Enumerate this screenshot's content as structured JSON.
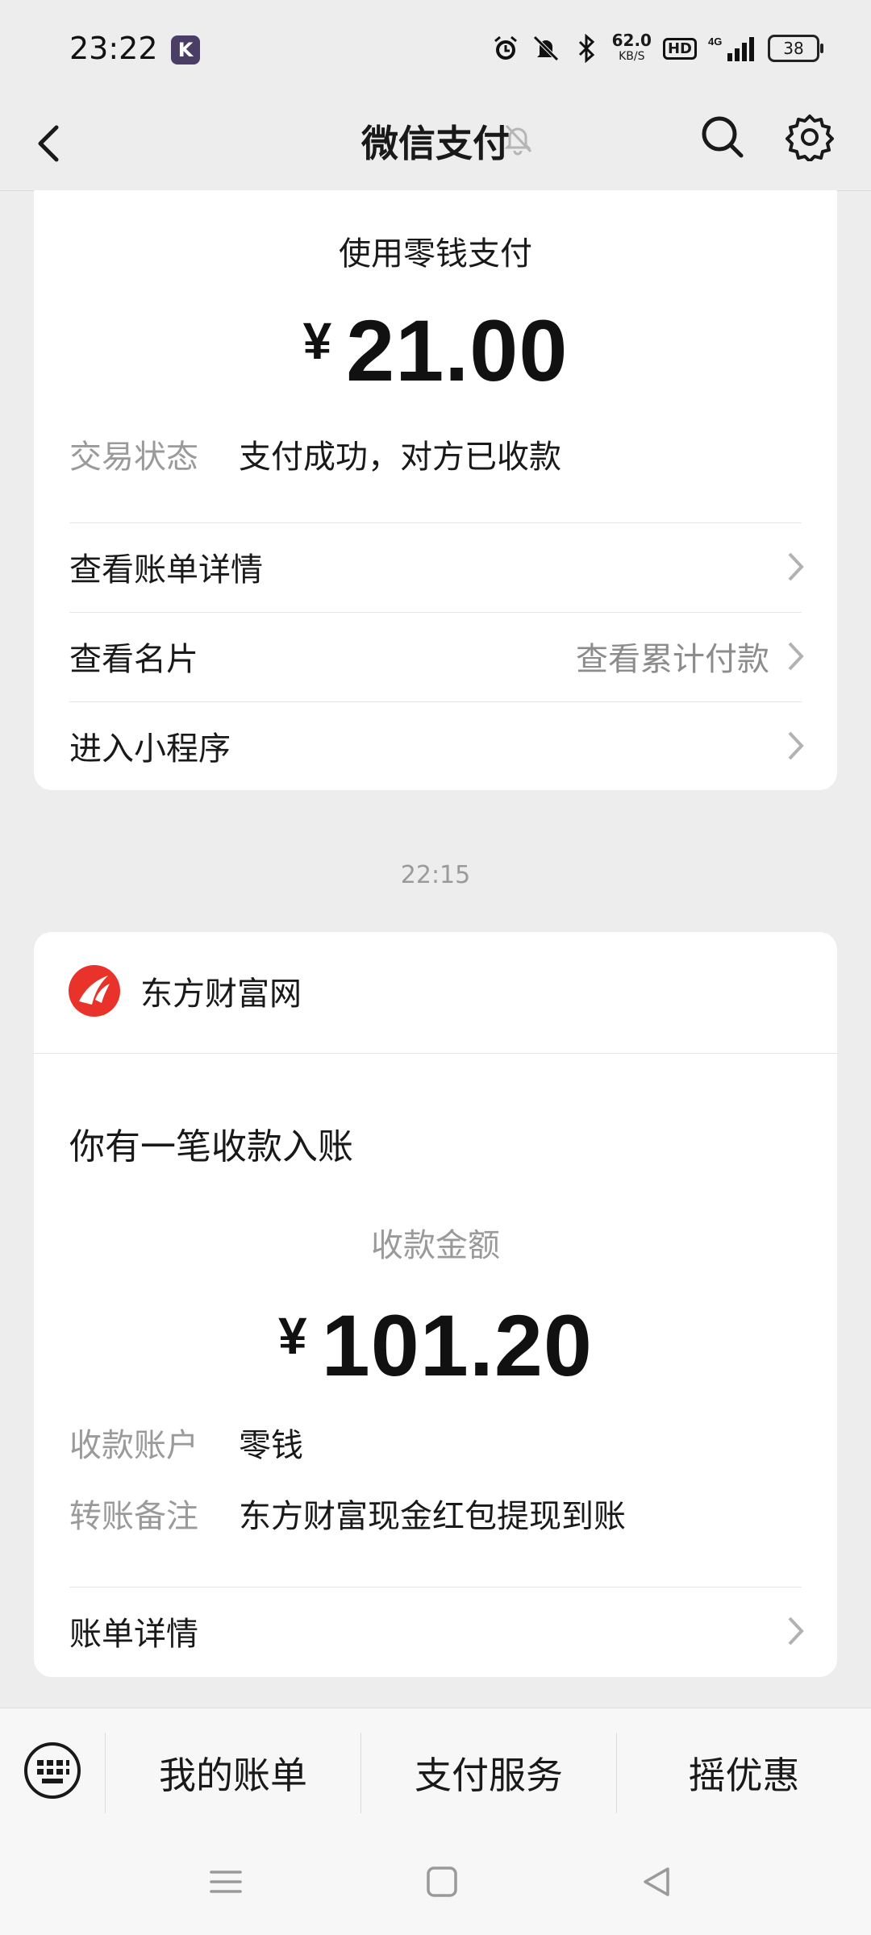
{
  "status_bar": {
    "time": "23:22",
    "app_badge": "K",
    "net_speed": "62.0",
    "net_unit": "KB/S",
    "hd": "HD",
    "network": "4G",
    "battery": "38"
  },
  "header": {
    "title": "微信支付"
  },
  "payment_card": {
    "title": "使用零钱支付",
    "currency": "¥",
    "amount": "21.00",
    "status_label": "交易状态",
    "status_value": "支付成功，对方已收款",
    "rows": [
      {
        "label": "查看账单详情",
        "extra": ""
      },
      {
        "label": "查看名片",
        "extra": "查看累计付款"
      },
      {
        "label": "进入小程序",
        "extra": ""
      }
    ]
  },
  "timestamp": "22:15",
  "receipt_card": {
    "merchant": "东方财富网",
    "notice": "你有一笔收款入账",
    "amount_label": "收款金额",
    "currency": "¥",
    "amount": "101.20",
    "account_label": "收款账户",
    "account_value": "零钱",
    "note_label": "转账备注",
    "note_value": "东方财富现金红包提现到账",
    "detail_label": "账单详情"
  },
  "bottom_menu": {
    "items": [
      "我的账单",
      "支付服务",
      "摇优惠"
    ]
  },
  "colors": {
    "background": "#ededed",
    "card": "#ffffff",
    "muted_text": "#9a9a9a",
    "merchant_logo": "#e8322a"
  }
}
